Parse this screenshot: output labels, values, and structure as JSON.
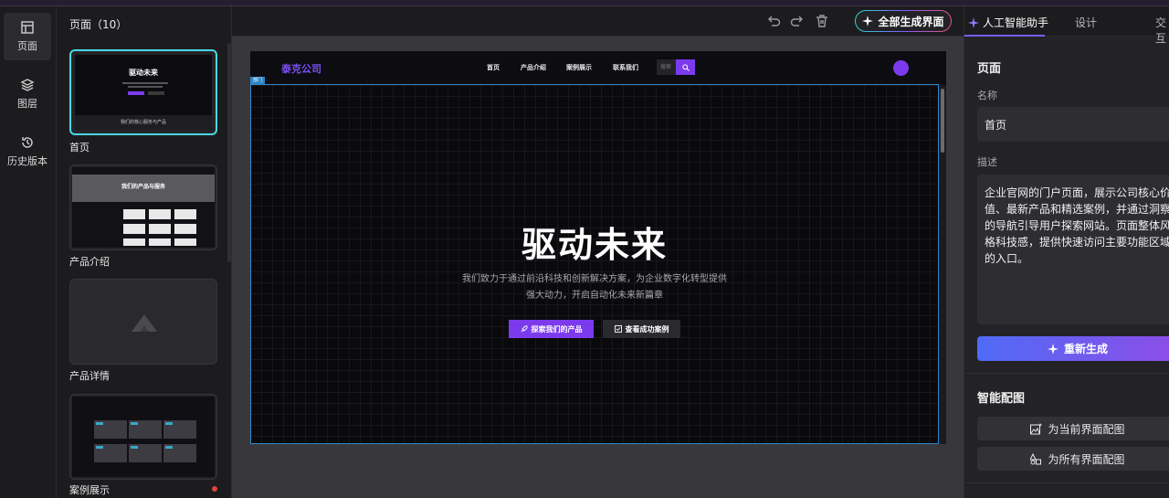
{
  "rail": {
    "items": [
      {
        "label": "页面",
        "icon": "layout-icon"
      },
      {
        "label": "图层",
        "icon": "layers-icon"
      },
      {
        "label": "历史版本",
        "icon": "history-icon"
      }
    ]
  },
  "pages_panel": {
    "title": "页面（10）",
    "items": [
      {
        "label": "首页",
        "preview_title": "驱动未来",
        "preview_footer": "我们的核心服务与产品"
      },
      {
        "label": "产品介绍",
        "preview_title": "我们的产品与服务"
      },
      {
        "label": "产品详情"
      },
      {
        "label": "案例展示"
      }
    ]
  },
  "toolbar": {
    "generate_all_label": "全部生成界面"
  },
  "canvas": {
    "nav": {
      "brand": "泰克公司",
      "links": [
        "首页",
        "产品介绍",
        "案例展示",
        "联系我们"
      ],
      "search_placeholder": "搜索"
    },
    "selection_tag": "部门",
    "hero": {
      "title": "驱动未来",
      "subtitle": "我们致力于通过前沿科技和创新解决方案，为企业数字化转型提供强大动力，开启自动化未来新篇章",
      "primary_button": "探索我们的产品",
      "secondary_button": "查看成功案例"
    }
  },
  "right_panel": {
    "tabs": [
      "人工智能助手",
      "设计",
      "交互"
    ],
    "page_section_title": "页面",
    "name_label": "名称",
    "name_value": "首页",
    "desc_label": "描述",
    "desc_value": "企业官网的门户页面，展示公司核心价值、最新产品和精选案例，并通过洞察的导航引导用户探索网站。页面整体风格科技感，提供快速访问主要功能区域的入口。",
    "regenerate_button": "重新生成",
    "smart_image_title": "智能配图",
    "image_current_button": "为当前界面配图",
    "image_all_button": "为所有界面配图"
  },
  "colors": {
    "accent_purple": "#7c3aed",
    "selection_cyan": "#4dd6e6",
    "selection_blue": "#2f86c8"
  }
}
